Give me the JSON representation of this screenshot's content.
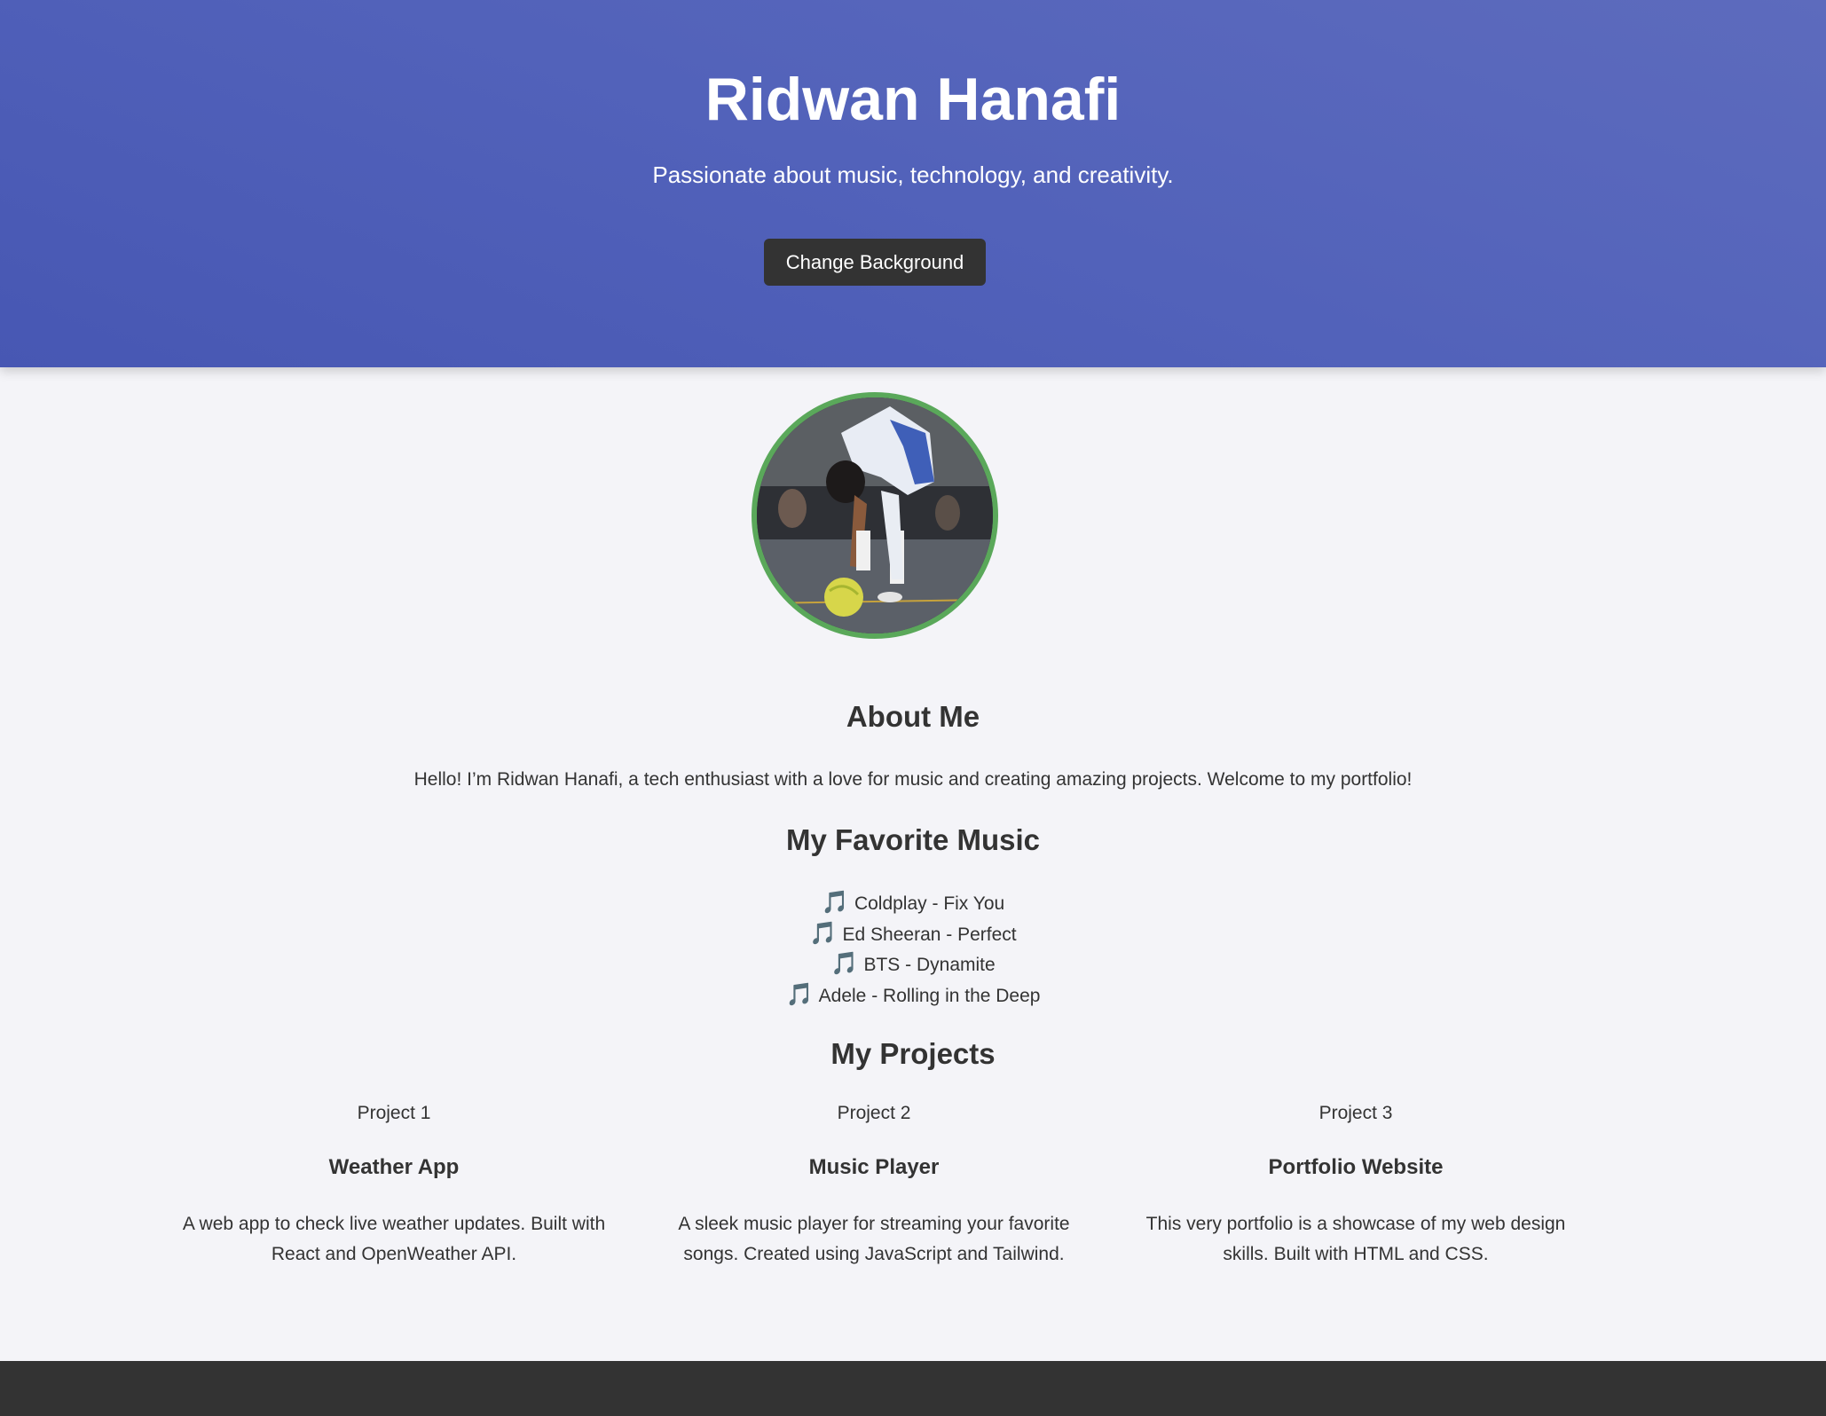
{
  "header": {
    "name": "Ridwan Hanafi",
    "tagline": "Passionate about music, technology, and creativity.",
    "button_label": "Change Background",
    "background_color": "#5262ba"
  },
  "profile": {
    "photo_icon": "profile-photo",
    "border_color": "#5aa85a"
  },
  "about": {
    "title": "About Me",
    "text": "Hello! I’m Ridwan Hanafi, a tech enthusiast with a love for music and creating amazing projects. Welcome to my portfolio!"
  },
  "music": {
    "title": "My Favorite Music",
    "note_icon": "🎵",
    "items": [
      "Coldplay - Fix You",
      "Ed Sheeran - Perfect",
      "BTS - Dynamite",
      "Adele - Rolling in the Deep"
    ]
  },
  "projects": {
    "title": "My Projects",
    "items": [
      {
        "label": "Project 1",
        "name": "Weather App",
        "description": "A web app to check live weather updates. Built with React and OpenWeather API."
      },
      {
        "label": "Project 2",
        "name": "Music Player",
        "description": "A sleek music player for streaming your favorite songs. Created using JavaScript and Tailwind."
      },
      {
        "label": "Project 3",
        "name": "Portfolio Website",
        "description": "This very portfolio is a showcase of my web design skills. Built with HTML and CSS."
      }
    ]
  },
  "footer": {
    "background_color": "#333333"
  }
}
